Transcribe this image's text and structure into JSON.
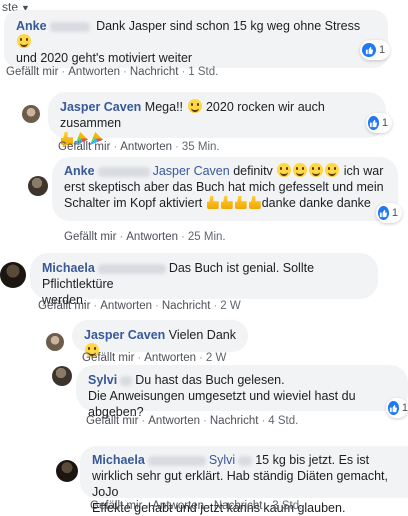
{
  "sort_label": "ste",
  "actions": {
    "like": "Gefällt mir",
    "reply": "Antworten",
    "message": "Nachricht"
  },
  "comments": [
    {
      "author": "Anke",
      "text_1": "Dank Jasper sind schon 15 kg weg ohne Stress",
      "text_2": "und 2020 geht's motiviert weiter",
      "time": "1 Std.",
      "reactions": "1"
    },
    {
      "author": "Jasper Caven",
      "text_1": "Mega!!",
      "text_2": "2020 rocken wir auch zusammen",
      "time": "35 Min.",
      "reactions": "1"
    },
    {
      "author": "Anke",
      "mention": "Jasper Caven",
      "text_1": "definitv",
      "text_1b": "ich war",
      "text_2": "erst skeptisch aber das Buch hat mich gefesselt und mein",
      "text_3": "Schalter im Kopf aktiviert",
      "text_3b": "danke danke danke",
      "time": "25 Min.",
      "reactions": "1"
    },
    {
      "author": "Michaela",
      "text_1": "Das Buch ist genial. Sollte Pflichtlektüre",
      "text_2": "werden.",
      "time": "2 W"
    },
    {
      "author": "Jasper Caven",
      "text_1": "Vielen Dank",
      "time": "2 W"
    },
    {
      "author": "Sylvi",
      "text_1": "Du hast das Buch gelesen.",
      "text_2": "Die Anweisungen umgesetzt und wieviel hast du abgeben?",
      "time": "4 Std.",
      "reactions": "1"
    },
    {
      "author": "Michaela",
      "mention": "Sylvi",
      "text_1": "15 kg bis jetzt. Es ist",
      "text_2": "wirklich sehr gut erklärt. Hab ständig Diäten gemacht, JoJo",
      "text_3": "Effekte gehabt und jetzt kanns kaum glauben.",
      "time": "3 Std."
    }
  ]
}
